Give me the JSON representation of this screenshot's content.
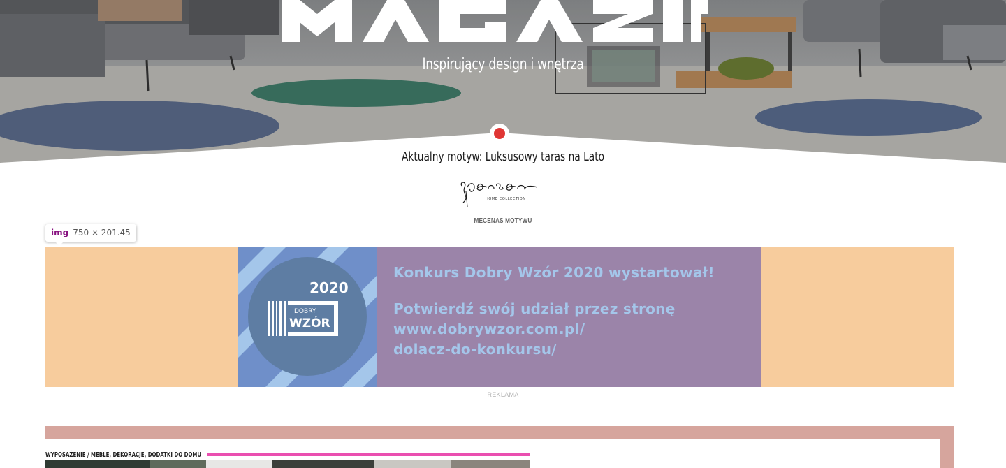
{
  "hero": {
    "tagline": "Inspirujący design i wnętrza",
    "current_theme": "Aktualny motyw: Luksusowy taras na Lato",
    "sponsor_label": "MECENAS MOTYWU"
  },
  "devtools_tooltip": {
    "tag": "img",
    "size": "750 × 201.45"
  },
  "ad": {
    "year": "2020",
    "badge_top": "DOBRY",
    "badge_bottom": "WZÓR",
    "line1": "Konkurs Dobry Wzór 2020 wystartował!",
    "line2": "Potwierdź swój udział przez stronę",
    "line3": "www.dobrywzor.com.pl/",
    "line4": "dolacz-do-konkursu/",
    "label": "REKLAMA",
    "colors": {
      "band": "#f7cc9d",
      "panel": "#9b84a9",
      "text": "#a4c6ea"
    }
  },
  "featured": {
    "category": "WYPOSAŻENIE / MEBLE, DEKORACJE, DODATKI DO DOMU",
    "accent_color": "#ea4fb0",
    "frame_color": "#d6a59d"
  },
  "icons": {
    "theme_marker": "red-dot-icon",
    "sponsor": "spensen-logo",
    "site_logo": "magazif-logo"
  }
}
